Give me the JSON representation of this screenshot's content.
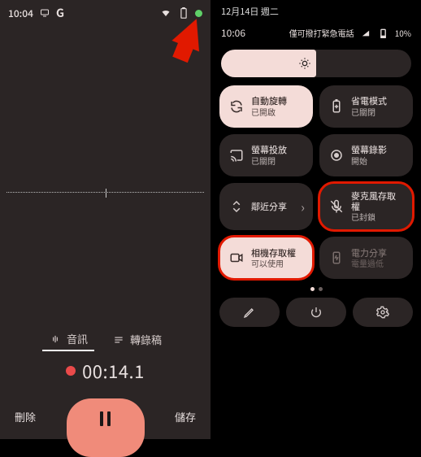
{
  "left": {
    "status_time": "10:04",
    "g": "G",
    "tab_audio": "音訊",
    "tab_transcript": "轉錄稿",
    "rec_time": "00:14.1",
    "delete": "刪除",
    "save": "儲存"
  },
  "right": {
    "date": "12月14日 週二",
    "status_time": "10:06",
    "status_text": "僅可撥打緊急電話",
    "battery": "10%",
    "tiles": [
      {
        "title": "自動旋轉",
        "sub": "已開啟"
      },
      {
        "title": "省電模式",
        "sub": "已關閉"
      },
      {
        "title": "螢幕投放",
        "sub": "已關閉"
      },
      {
        "title": "螢幕錄影",
        "sub": "開始"
      },
      {
        "title": "鄰近分享",
        "sub": ""
      },
      {
        "title": "麥克風存取權",
        "sub": "已封鎖"
      },
      {
        "title": "相機存取權",
        "sub": "可以使用"
      },
      {
        "title": "電力分享",
        "sub": "電量過低"
      }
    ]
  }
}
